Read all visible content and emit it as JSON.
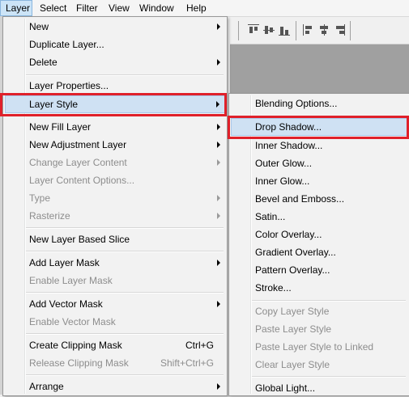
{
  "menubar": {
    "items": [
      {
        "label": "Layer",
        "active": true
      },
      {
        "label": "Select"
      },
      {
        "label": "Filter"
      },
      {
        "label": "View"
      },
      {
        "label": "Window"
      },
      {
        "label": "Help"
      }
    ]
  },
  "layer_menu": {
    "new": "New",
    "duplicate_layer": "Duplicate Layer...",
    "delete": "Delete",
    "layer_properties": "Layer Properties...",
    "layer_style": "Layer Style",
    "new_fill_layer": "New Fill Layer",
    "new_adjustment_layer": "New Adjustment Layer",
    "change_layer_content": "Change Layer Content",
    "layer_content_options": "Layer Content Options...",
    "type": "Type",
    "rasterize": "Rasterize",
    "new_layer_based_slice": "New Layer Based Slice",
    "add_layer_mask": "Add Layer Mask",
    "enable_layer_mask": "Enable Layer Mask",
    "add_vector_mask": "Add Vector Mask",
    "enable_vector_mask": "Enable Vector Mask",
    "create_clipping_mask": "Create Clipping Mask",
    "create_clipping_mask_shortcut": "Ctrl+G",
    "release_clipping_mask": "Release Clipping Mask",
    "release_clipping_mask_shortcut": "Shift+Ctrl+G",
    "arrange": "Arrange"
  },
  "layer_style_submenu": {
    "blending_options": "Blending Options...",
    "drop_shadow": "Drop Shadow...",
    "inner_shadow": "Inner Shadow...",
    "outer_glow": "Outer Glow...",
    "inner_glow": "Inner Glow...",
    "bevel_and_emboss": "Bevel and Emboss...",
    "satin": "Satin...",
    "color_overlay": "Color Overlay...",
    "gradient_overlay": "Gradient Overlay...",
    "pattern_overlay": "Pattern Overlay...",
    "stroke": "Stroke...",
    "copy_layer_style": "Copy Layer Style",
    "paste_layer_style": "Paste Layer Style",
    "paste_layer_style_to_linked": "Paste Layer Style to Linked",
    "clear_layer_style": "Clear Layer Style",
    "global_light": "Global Light..."
  },
  "colors": {
    "highlight": "#cfe1f3",
    "annotation_red": "#e0202a",
    "disabled_text": "#8d8d8d"
  }
}
